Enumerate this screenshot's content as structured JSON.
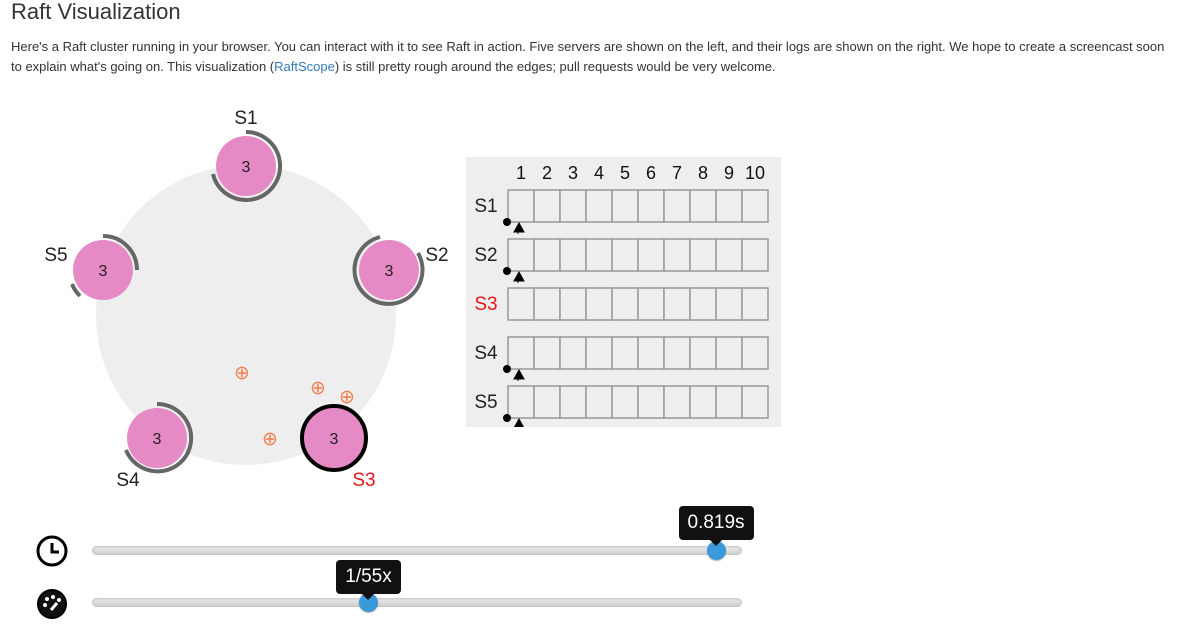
{
  "page": {
    "title": "Raft Visualization",
    "intro_before": "Here's a Raft cluster running in your browser. You can interact with it to see Raft in action. Five servers are shown on the left, and their logs are shown on the right. We hope to create a screencast soon to explain what's going on. This visualization (",
    "intro_link": "RaftScope",
    "intro_after": ") is still pretty rough around the edges; pull requests would be very welcome."
  },
  "servers": [
    {
      "id": "S1",
      "term": "3",
      "state": "follower"
    },
    {
      "id": "S2",
      "term": "3",
      "state": "follower"
    },
    {
      "id": "S3",
      "term": "3",
      "state": "candidate"
    },
    {
      "id": "S4",
      "term": "3",
      "state": "follower"
    },
    {
      "id": "S5",
      "term": "3",
      "state": "follower"
    }
  ],
  "messages": {
    "count": 4,
    "glyph": "⊕"
  },
  "log": {
    "columns": [
      "1",
      "2",
      "3",
      "4",
      "5",
      "6",
      "7",
      "8",
      "9",
      "10"
    ],
    "rows": [
      {
        "server": "S1",
        "markers": true
      },
      {
        "server": "S2",
        "markers": true
      },
      {
        "server": "S3",
        "markers": false
      },
      {
        "server": "S4",
        "markers": true
      },
      {
        "server": "S5",
        "markers": true
      }
    ]
  },
  "controls": {
    "time": {
      "value_label": "0.819s",
      "fraction": 0.96,
      "icon": "clock-icon"
    },
    "speed": {
      "value_label": "1/55x",
      "fraction": 0.425,
      "icon": "speedometer-icon"
    }
  },
  "colors": {
    "server_fill": "#e68ac6",
    "timeout_arc": "#666666",
    "candidate": "#e8141a",
    "message": "#f07f50",
    "ring": "#eeeeee",
    "slider_thumb": "#3a99d8",
    "link": "#337ab7"
  }
}
